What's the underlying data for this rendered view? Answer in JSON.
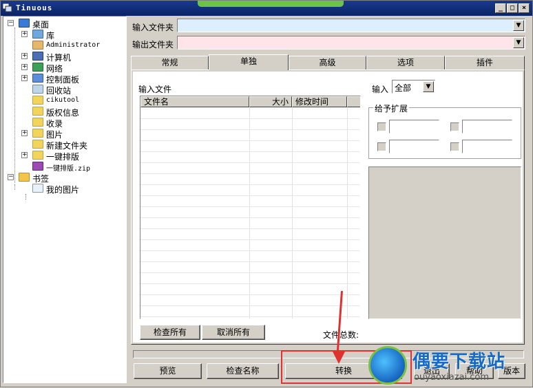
{
  "window": {
    "title": "Tinuous"
  },
  "tree": {
    "items": [
      {
        "label": "桌面",
        "level": 0,
        "icon": "desktop-icon",
        "expander": "−"
      },
      {
        "label": "库",
        "level": 1,
        "icon": "library-icon",
        "expander": "+"
      },
      {
        "label": "Administrator",
        "level": 1,
        "icon": "user-icon",
        "expander": ""
      },
      {
        "label": "计算机",
        "level": 1,
        "icon": "computer-icon",
        "expander": "+"
      },
      {
        "label": "网络",
        "level": 1,
        "icon": "network-icon",
        "expander": "+"
      },
      {
        "label": "控制面板",
        "level": 1,
        "icon": "control-panel-icon",
        "expander": "+"
      },
      {
        "label": "回收站",
        "level": 1,
        "icon": "recycle-bin-icon",
        "expander": ""
      },
      {
        "label": "cikutool",
        "level": 1,
        "icon": "folder-icon",
        "expander": ""
      },
      {
        "label": "版权信息",
        "level": 1,
        "icon": "folder-icon",
        "expander": ""
      },
      {
        "label": "收录",
        "level": 1,
        "icon": "folder-icon",
        "expander": ""
      },
      {
        "label": "图片",
        "level": 1,
        "icon": "folder-icon",
        "expander": "+"
      },
      {
        "label": "新建文件夹",
        "level": 1,
        "icon": "folder-icon",
        "expander": ""
      },
      {
        "label": "一键排版",
        "level": 1,
        "icon": "folder-icon",
        "expander": "+"
      },
      {
        "label": "一键排版.zip",
        "level": 1,
        "icon": "zip-archive-icon",
        "expander": ""
      },
      {
        "label": "书签",
        "level": 0,
        "icon": "bookmark-folder-icon",
        "expander": "−"
      },
      {
        "label": "我的图片",
        "level": 1,
        "icon": "image-file-icon",
        "expander": ""
      }
    ]
  },
  "paths": {
    "input_label": "输入文件夹",
    "output_label": "输出文件夹",
    "input_value": "",
    "output_value": ""
  },
  "tabs": [
    {
      "label": "常规",
      "active": false
    },
    {
      "label": "单独",
      "active": true
    },
    {
      "label": "高级",
      "active": false
    },
    {
      "label": "选项",
      "active": false
    },
    {
      "label": "插件",
      "active": false
    }
  ],
  "panel": {
    "input_files_label": "输入文件",
    "columns": [
      "文件名",
      "大小",
      "修改时间"
    ],
    "check_all": "检查所有",
    "uncheck_all": "取消所有",
    "file_count_label": "文件总数:",
    "input_filter_label": "输入",
    "input_filter_value": "全部",
    "ext_group_title": "给予扩展"
  },
  "bottom": {
    "preview": "预览",
    "check_names": "检查名称",
    "convert": "转换",
    "exit": "退出",
    "help": "帮助",
    "version": "版本"
  },
  "watermark": {
    "text": "偶要下载站",
    "url": "ouyaoxiazai.com"
  },
  "colors": {
    "input_field": "#ddeeff",
    "output_field": "#ffe4ea",
    "highlight": "#e53030",
    "watermark": "#1569c7"
  }
}
